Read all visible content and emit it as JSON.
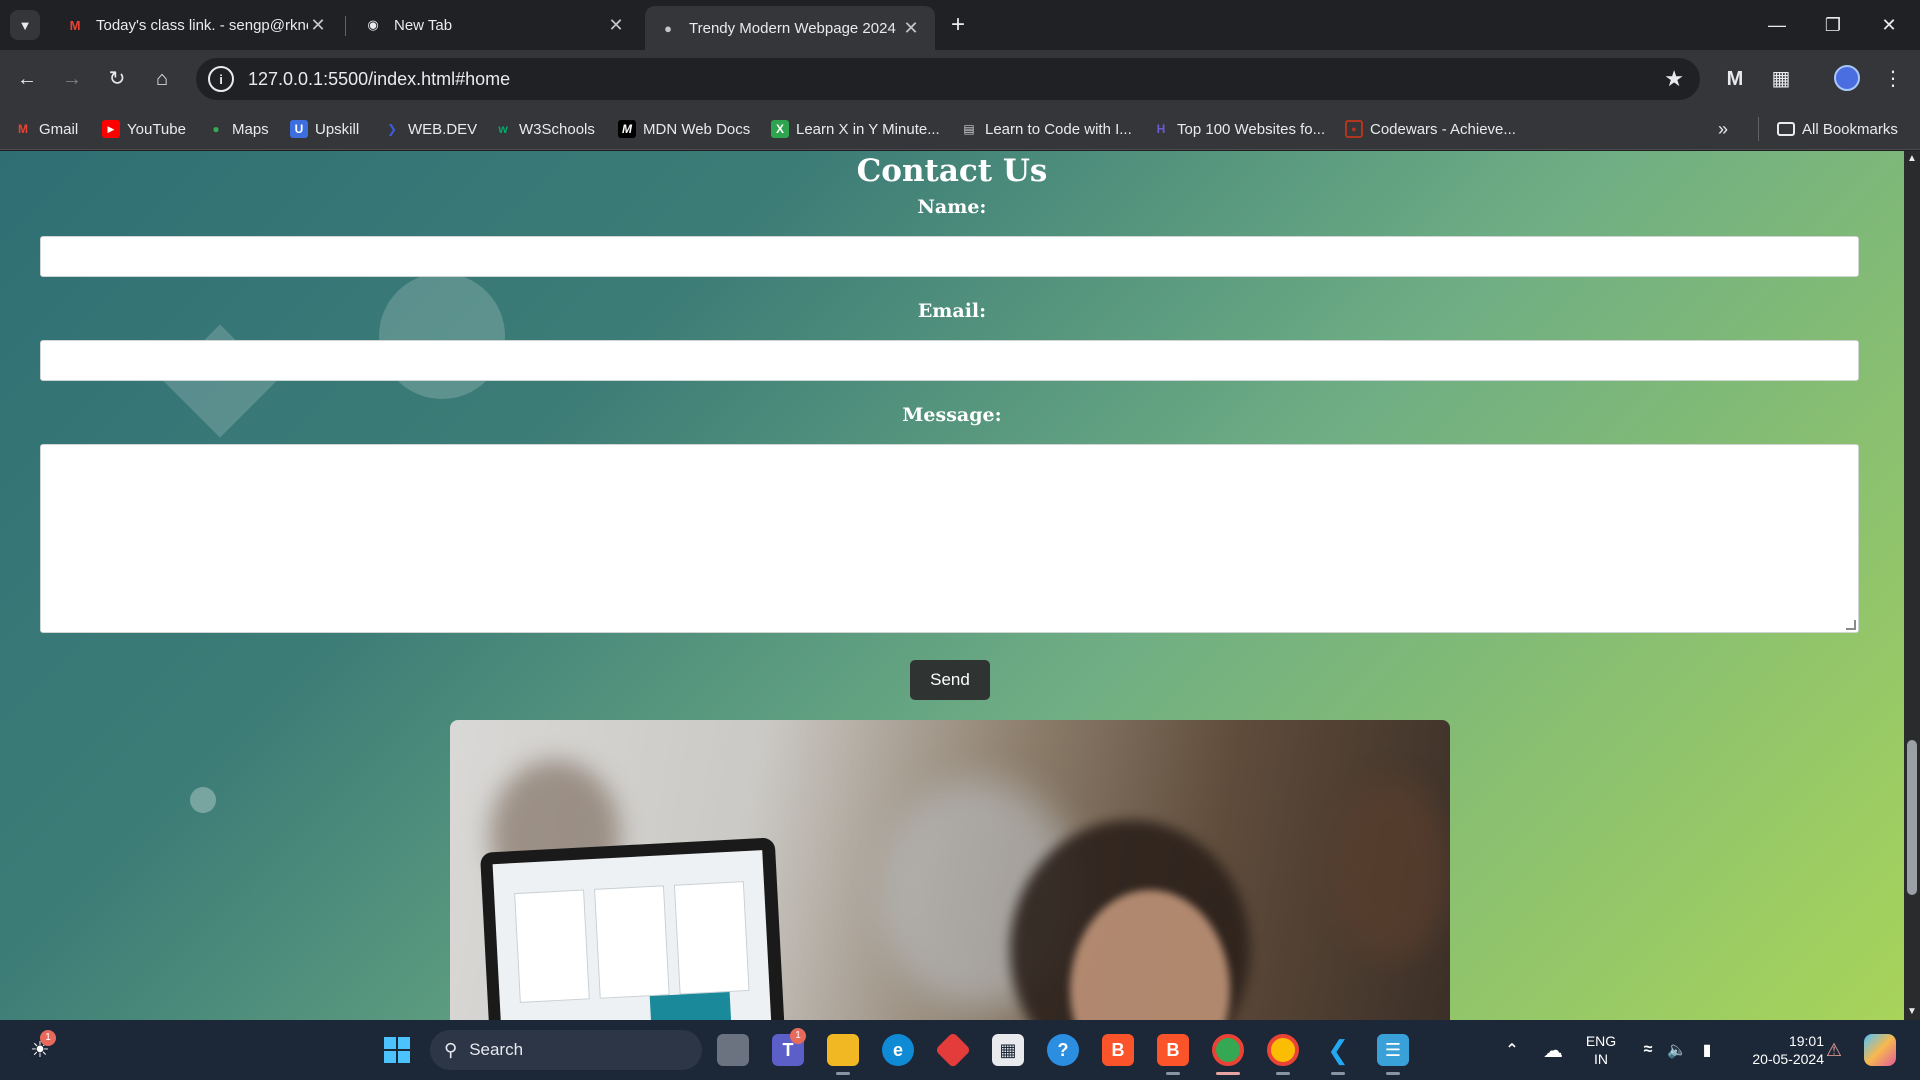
{
  "tabs": [
    {
      "title": "Today's class link. - sengp@rknec.edu",
      "favicon": "gmail-icon",
      "active": false
    },
    {
      "title": "New Tab",
      "favicon": "chrome-icon",
      "active": false
    },
    {
      "title": "Trendy Modern Webpage 2024",
      "favicon": "globe-icon",
      "active": true
    }
  ],
  "address_bar": {
    "url": "127.0.0.1:5500/index.html#home"
  },
  "bookmarks": [
    {
      "label": "Gmail",
      "icon": "gmail-icon",
      "color": "#ea4335"
    },
    {
      "label": "YouTube",
      "icon": "youtube-icon",
      "color": "#ff0000"
    },
    {
      "label": "Maps",
      "icon": "maps-icon",
      "color": "#34a853"
    },
    {
      "label": "Upskill",
      "icon": "upskill-icon",
      "color": "#3c6ee0"
    },
    {
      "label": "WEB.DEV",
      "icon": "webdev-icon",
      "color": "#3b5bdb"
    },
    {
      "label": "W3Schools",
      "icon": "w3schools-icon",
      "color": "#04aa6d"
    },
    {
      "label": "MDN Web Docs",
      "icon": "mdn-icon",
      "color": "#000000"
    },
    {
      "label": "Learn X in Y Minute...",
      "icon": "learnx-icon",
      "color": "#2ea44f"
    },
    {
      "label": "Learn to Code with I...",
      "icon": "code-icon",
      "color": "#d0d0d0"
    },
    {
      "label": "Top 100 Websites fo...",
      "icon": "top100-icon",
      "color": "#6b5bd6"
    },
    {
      "label": "Codewars - Achieve...",
      "icon": "codewars-icon",
      "color": "#b1361e"
    }
  ],
  "all_bookmarks_label": "All Bookmarks",
  "page": {
    "contact_title": "Contact Us",
    "name_label": "Name:",
    "email_label": "Email:",
    "message_label": "Message:",
    "send_label": "Send"
  },
  "taskbar": {
    "search_label": "Search",
    "lang_line1": "ENG",
    "lang_line2": "IN",
    "time": "19:01",
    "date": "20-05-2024",
    "weather_badge": "1",
    "teams_badge": "1"
  },
  "colors": {
    "gradient_start": "#2f6f74",
    "gradient_end": "#a8d45a",
    "send_button": "#2f3432"
  }
}
